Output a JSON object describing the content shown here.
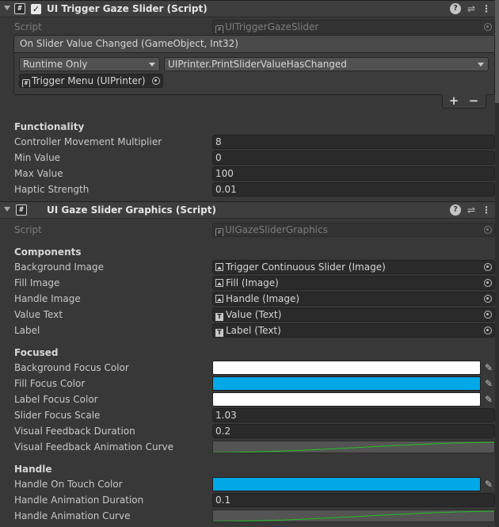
{
  "component1": {
    "title": "UI Trigger Gaze Slider (Script)",
    "enabled": true,
    "script_label": "Script",
    "script_value": "UITriggerGazeSlider",
    "event": {
      "header": "On Slider Value Changed (GameObject, Int32)",
      "mode": "Runtime Only",
      "function": "UIPrinter.PrintSliderValueHasChanged",
      "target": "Trigger Menu (UIPrinter)",
      "plus": "+",
      "minus": "−"
    },
    "functionality": {
      "section": "Functionality",
      "rows": [
        {
          "label": "Controller Movement Multiplier",
          "value": "8"
        },
        {
          "label": "Min Value",
          "value": "0"
        },
        {
          "label": "Max Value",
          "value": "100"
        },
        {
          "label": "Haptic Strength",
          "value": "0.01"
        }
      ]
    }
  },
  "component2": {
    "title": "UI Gaze Slider Graphics (Script)",
    "script_label": "Script",
    "script_value": "UIGazeSliderGraphics",
    "components": {
      "section": "Components",
      "rows": [
        {
          "label": "Background Image",
          "value": "Trigger Continuous Slider (Image)",
          "icon": "image-icon"
        },
        {
          "label": "Fill Image",
          "value": "Fill (Image)",
          "icon": "image-icon"
        },
        {
          "label": "Handle Image",
          "value": "Handle (Image)",
          "icon": "image-icon"
        },
        {
          "label": "Value Text",
          "value": "Value (Text)",
          "icon": "text-icon"
        },
        {
          "label": "Label",
          "value": "Label (Text)",
          "icon": "text-icon"
        }
      ]
    },
    "focused": {
      "section": "Focused",
      "background_focus_color": {
        "label": "Background Focus Color",
        "color": "#ffffff"
      },
      "fill_focus_color": {
        "label": "Fill Focus Color",
        "color": "#00a8e8"
      },
      "label_focus_color": {
        "label": "Label Focus Color",
        "color": "#ffffff"
      },
      "slider_focus_scale": {
        "label": "Slider Focus Scale",
        "value": "1.03"
      },
      "visual_feedback_duration": {
        "label": "Visual Feedback Duration",
        "value": "0.2"
      },
      "visual_feedback_animation_curve": {
        "label": "Visual Feedback Animation Curve"
      }
    },
    "handle": {
      "section": "Handle",
      "handle_on_touch_color": {
        "label": "Handle On Touch Color",
        "color": "#00a8e8"
      },
      "handle_animation_duration": {
        "label": "Handle Animation Duration",
        "value": "0.1"
      },
      "handle_animation_curve": {
        "label": "Handle Animation Curve"
      }
    }
  },
  "colors": {
    "curve_line": "#22c022"
  }
}
